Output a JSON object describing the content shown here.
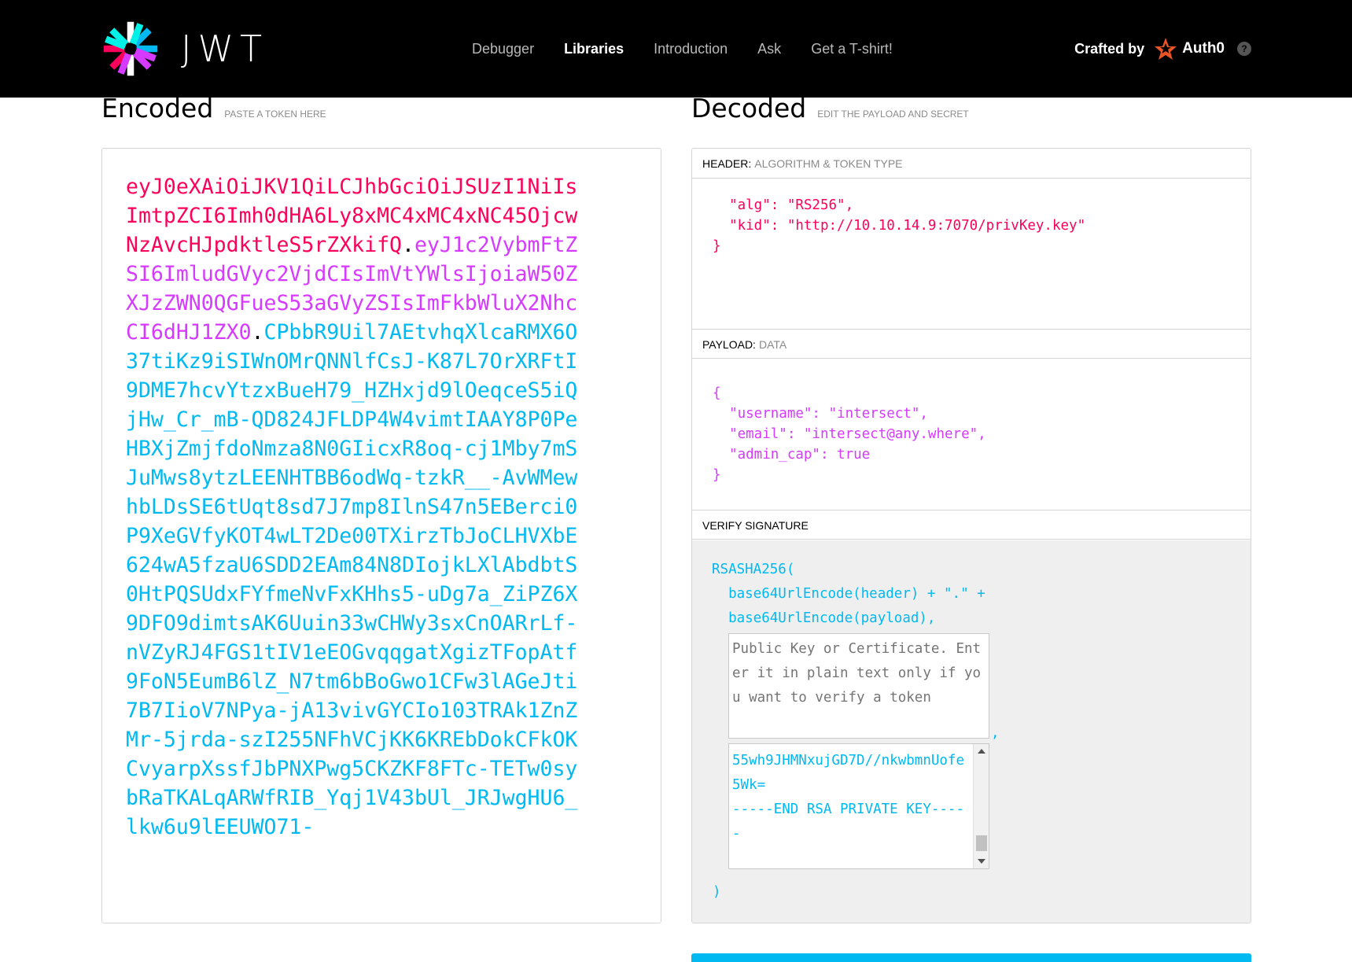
{
  "brand": {
    "name": "JWT"
  },
  "nav": {
    "items": [
      {
        "label": "Debugger",
        "active": false
      },
      {
        "label": "Libraries",
        "active": true
      },
      {
        "label": "Introduction",
        "active": false
      },
      {
        "label": "Ask",
        "active": false
      },
      {
        "label": "Get a T-shirt!",
        "active": false
      }
    ],
    "crafted_by": "Crafted by",
    "crafted_brand": "Auth0",
    "help": "?"
  },
  "encoded": {
    "title": "Encoded",
    "hint": "PASTE A TOKEN HERE",
    "token_header": "eyJ0eXAiOiJKV1QiLCJhbGciOiJSUzI1NiIsImtpZCI6Imh0dHA6Ly8xMC4xMC4xNC45OjcwNzAvcHJpdktleS5rZXkifQ",
    "dot": ".",
    "token_payload": "eyJ1c2VybmFtZSI6ImludGVyc2VjdCIsImVtYWlsIjoiaW50ZXJzZWN0QGFueS53aGVyZSIsImFkbWluX2NhcCI6dHJ1ZX0",
    "token_signature": "CPbbR9Uil7AEtvhqXlcaRMX6O37tiKz9iSIWnOMrQNNlfCsJ-K87L7OrXRFtI9DME7hcvYtzxBueH79_HZHxjd9lOeqceS5iQjHw_Cr_mB-QD824JFLDP4W4vimtIAAY8P0PeHBXjZmjfdoNmza8N0GIicxR8oq-cj1Mby7mSJuMws8ytzLEENHTBB6odWq-tzkR__-AvWMewhbLDsSE6tUqt8sd7J7mp8IlnS47n5EBerci0P9XeGVfyKOT4wLT2De00TXirzTbJoCLHVXbE624wA5fzaU6SDD2EAm84N8DIojkLXlAbdbtS0HtPQSUdxFYfmeNvFxKHhs5-uDg7a_ZiPZ6X9DFO9dimtsAK6Uuin33wCHWy3sxCnOARrLf-nVZyRJ4FGS1tIV1eEOGvqqgatXgizTFopAtf9FoN5EumB6lZ_N7tm6bBoGwo1CFw3lAGeJti7B7IioV7NPya-jA13vivGYCIo103TRAk1ZnZMr-5jrda-szI255NFhVCjKK6KREbDokCFkOKCvyarpXssfJbPNXPwg5CKZKF8FTc-TETw0sybRaTKALqARWfRIB_Yqj1V43bUl_JRJwgHU6_lkw6u9lEEUWO71-"
  },
  "decoded": {
    "title": "Decoded",
    "hint": "EDIT THE PAYLOAD AND SECRET",
    "header_section": {
      "label": "HEADER:",
      "sub": "ALGORITHM & TOKEN TYPE",
      "lines": [
        "  \"alg\": \"RS256\",",
        "  \"kid\": \"http://10.10.14.9:7070/privKey.key\"",
        "}"
      ]
    },
    "payload_section": {
      "label": "PAYLOAD:",
      "sub": "DATA",
      "lines": [
        "{",
        "  \"username\": \"intersect\",",
        "  \"email\": \"intersect@any.where\",",
        "  \"admin_cap\": true",
        "}"
      ]
    },
    "signature_section": {
      "label": "VERIFY SIGNATURE",
      "func": "RSASHA256(",
      "line1": "  base64UrlEncode(header) + \".\" +",
      "line2": "  base64UrlEncode(payload),",
      "public_key_placeholder": "Public Key or Certificate. Enter it in plain text only if you want to verify a token",
      "comma": ",",
      "private_key_lines": [
        "55wh9JHMNxujGD7D//nkwbmnUofe",
        "5Wk=",
        "-----END RSA PRIVATE KEY----",
        "-"
      ],
      "close": ")"
    }
  },
  "colors": {
    "header": "#fb015b",
    "payload": "#d63aff",
    "signature": "#00b9f1"
  }
}
